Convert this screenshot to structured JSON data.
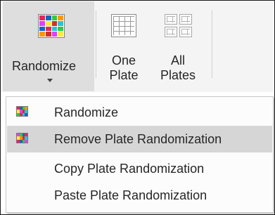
{
  "ribbon": {
    "randomize_label": "Randomize",
    "one_plate_label": "One Plate",
    "one_plate_line1": "One",
    "one_plate_line2": "Plate",
    "all_plates_line1": "All",
    "all_plates_line2": "Plates",
    "randomize_icon": "color-grid-icon",
    "one_plate_icon": "single-plate-grid-icon",
    "all_plates_icon": "multi-plate-grid-icon"
  },
  "menu": {
    "items": [
      {
        "label": "Randomize",
        "icon": "color-grid-icon",
        "highlighted": false
      },
      {
        "label": "Remove Plate Randomization",
        "icon": "color-grid-remove-icon",
        "highlighted": true
      },
      {
        "label": "Copy Plate Randomization",
        "icon": "",
        "highlighted": false
      },
      {
        "label": "Paste Plate Randomization",
        "icon": "",
        "highlighted": false
      }
    ]
  },
  "colors": {
    "ribbon_bg": "#f4f4f4",
    "pressed_button_bg": "#dedede",
    "menu_highlight": "#d6d6d6",
    "palette": [
      "#e8245c",
      "#2ecc40",
      "#1565c0",
      "#ff9800",
      "#e040fb",
      "#26c6da",
      "#ffeb3b",
      "#d32f2f"
    ]
  }
}
